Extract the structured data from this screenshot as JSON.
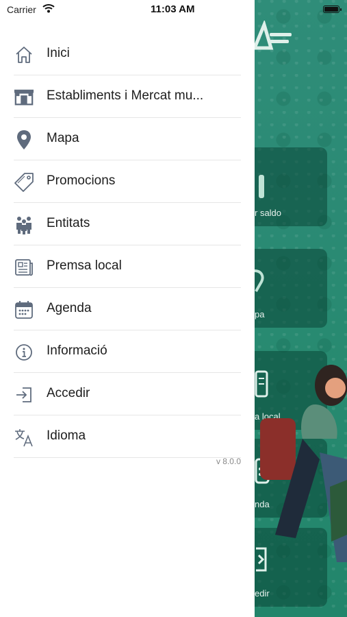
{
  "status_bar": {
    "carrier": "Carrier",
    "time": "11:03 AM"
  },
  "menu": {
    "items": [
      {
        "label": "Inici",
        "icon": "home-icon"
      },
      {
        "label": "Establiments i Mercat mu...",
        "icon": "store-icon"
      },
      {
        "label": "Mapa",
        "icon": "map-pin-icon"
      },
      {
        "label": "Promocions",
        "icon": "tag-icon"
      },
      {
        "label": "Entitats",
        "icon": "people-icon"
      },
      {
        "label": "Premsa local",
        "icon": "newspaper-icon"
      },
      {
        "label": "Agenda",
        "icon": "calendar-icon"
      },
      {
        "label": "Informació",
        "icon": "info-icon"
      },
      {
        "label": "Accedir",
        "icon": "login-icon"
      },
      {
        "label": "Idioma",
        "icon": "translate-icon"
      }
    ]
  },
  "version": "v 8.0.0",
  "background": {
    "tiles": [
      {
        "label": "r saldo"
      },
      {
        "label": "pa"
      },
      {
        "label": "a local"
      },
      {
        "label": "nda"
      },
      {
        "label": "edir"
      }
    ]
  },
  "colors": {
    "icon": "#5f6b7d",
    "accent_green": "#2b8a74"
  }
}
